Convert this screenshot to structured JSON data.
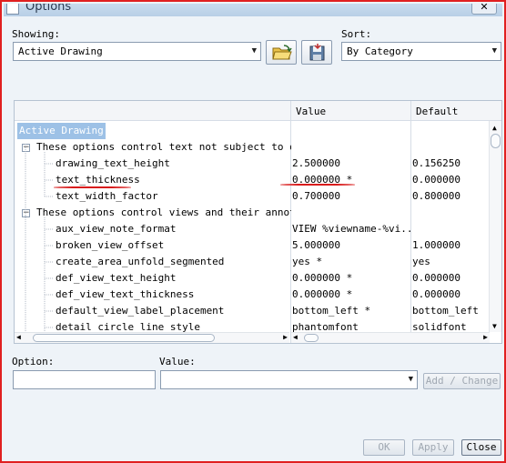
{
  "window": {
    "title": "Options",
    "close_glyph": "✕"
  },
  "showing": {
    "label": "Showing:",
    "value": "Active Drawing"
  },
  "sort": {
    "label": "Sort:",
    "value": "By Category"
  },
  "toolbar": {
    "open_icon": "folder-open-icon",
    "save_icon": "save-icon"
  },
  "grid": {
    "headers": {
      "value": "Value",
      "default": "Default"
    },
    "root": "Active Drawing",
    "groups": [
      {
        "label": "These options control text not subject to other",
        "expanded": true
      },
      {
        "label": "These options control views and their annotatio",
        "expanded": true
      }
    ],
    "rows": [
      {
        "name": "drawing_text_height",
        "value": "2.500000",
        "default": "0.156250"
      },
      {
        "name": "text_thickness",
        "value": "0.000000 *",
        "default": "0.000000"
      },
      {
        "name": "text_width_factor",
        "value": "0.700000",
        "default": "0.800000"
      },
      {
        "name": "aux_view_note_format",
        "value": "VIEW %viewname-%vi...",
        "default": ""
      },
      {
        "name": "broken_view_offset",
        "value": "5.000000",
        "default": "1.000000"
      },
      {
        "name": "create_area_unfold_segmented",
        "value": "yes *",
        "default": "yes"
      },
      {
        "name": "def_view_text_height",
        "value": "0.000000 *",
        "default": "0.000000"
      },
      {
        "name": "def_view_text_thickness",
        "value": "0.000000 *",
        "default": "0.000000"
      },
      {
        "name": "default_view_label_placement",
        "value": "bottom_left *",
        "default": "bottom_left"
      },
      {
        "name": "detail_circle_line_style",
        "value": "phantomfont",
        "default": "solidfont"
      }
    ]
  },
  "option": {
    "label": "Option:",
    "value": ""
  },
  "value_field": {
    "label": "Value:",
    "value": ""
  },
  "buttons": {
    "add_change": "Add / Change",
    "ok": "OK",
    "apply": "Apply",
    "close": "Close"
  },
  "colors": {
    "annotation": "#d81c1c",
    "selection": "#9dc1e6"
  }
}
